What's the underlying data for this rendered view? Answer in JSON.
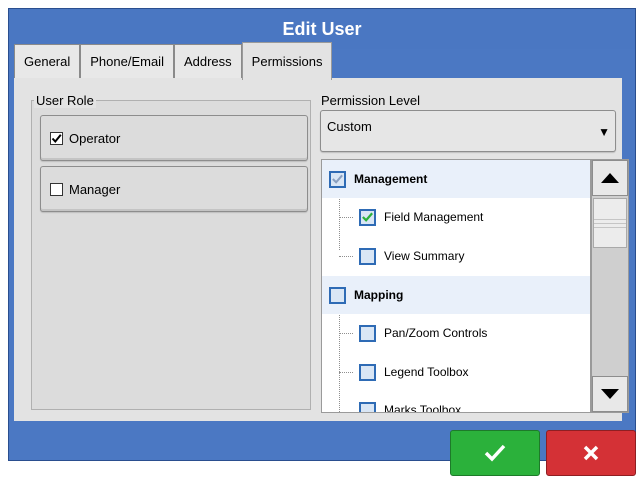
{
  "dialog": {
    "title": "Edit User"
  },
  "tabs": [
    {
      "label": "General",
      "active": false
    },
    {
      "label": "Phone/Email",
      "active": false
    },
    {
      "label": "Address",
      "active": false
    },
    {
      "label": "Permissions",
      "active": true
    }
  ],
  "user_role": {
    "label": "User Role",
    "options": [
      {
        "label": "Operator",
        "checked": true
      },
      {
        "label": "Manager",
        "checked": false
      }
    ]
  },
  "permission_level": {
    "label": "Permission Level",
    "value": "Custom"
  },
  "permissions_tree": [
    {
      "label": "Management",
      "type": "group",
      "checked": true
    },
    {
      "label": "Field Management",
      "type": "item",
      "checked": true
    },
    {
      "label": "View Summary",
      "type": "item",
      "checked": false
    },
    {
      "label": "Mapping",
      "type": "group",
      "checked": false
    },
    {
      "label": "Pan/Zoom Controls",
      "type": "item",
      "checked": false
    },
    {
      "label": "Legend Toolbox",
      "type": "item",
      "checked": false
    },
    {
      "label": "Marks Toolbox",
      "type": "item",
      "checked": false
    }
  ],
  "colors": {
    "title_bar": "#4a77c2",
    "ok_button": "#2bb13b",
    "cancel_button": "#d43136",
    "checkbox_border": "#2e6bb5"
  },
  "icons": {
    "ok": "checkmark-icon",
    "cancel": "x-icon",
    "scroll_up": "triangle-up-icon",
    "scroll_down": "triangle-down-icon",
    "dropdown": "triangle-down-icon"
  }
}
